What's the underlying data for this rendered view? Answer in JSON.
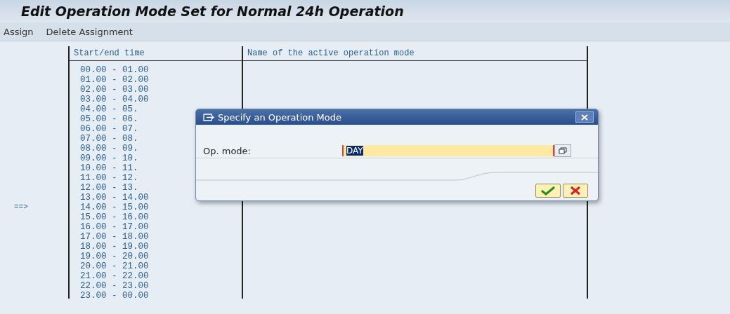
{
  "title": "Edit Operation Mode Set for Normal 24h Operation",
  "toolbar": [
    "Assign",
    "Delete Assignment"
  ],
  "table": {
    "columns": [
      "Start/end time",
      "Name of the active operation mode"
    ],
    "rows": [
      {
        "time": "00.00 - 01.00"
      },
      {
        "time": "01.00 - 02.00"
      },
      {
        "time": "02.00 - 03.00"
      },
      {
        "time": "03.00 - 04.00"
      },
      {
        "time": "04.00 - 05."
      },
      {
        "time": "05.00 - 06."
      },
      {
        "time": "06.00 - 07."
      },
      {
        "time": "07.00 - 08."
      },
      {
        "time": "08.00 - 09."
      },
      {
        "time": "09.00 - 10."
      },
      {
        "time": "10.00 - 11."
      },
      {
        "time": "11.00 - 12."
      },
      {
        "time": "12.00 - 13."
      },
      {
        "time": "13.00 - 14.00"
      },
      {
        "time": "14.00 - 15.00",
        "marker": "==>"
      },
      {
        "time": "15.00 - 16.00"
      },
      {
        "time": "16.00 - 17.00"
      },
      {
        "time": "17.00 - 18.00"
      },
      {
        "time": "18.00 - 19.00"
      },
      {
        "time": "19.00 - 20.00"
      },
      {
        "time": "20.00 - 21.00"
      },
      {
        "time": "21.00 - 22.00"
      },
      {
        "time": "22.00 - 23.00"
      },
      {
        "time": "23.00 - 00.00"
      }
    ]
  },
  "dialog": {
    "title": "Specify an Operation Mode",
    "label": "Op. mode:",
    "value": "DAY"
  }
}
